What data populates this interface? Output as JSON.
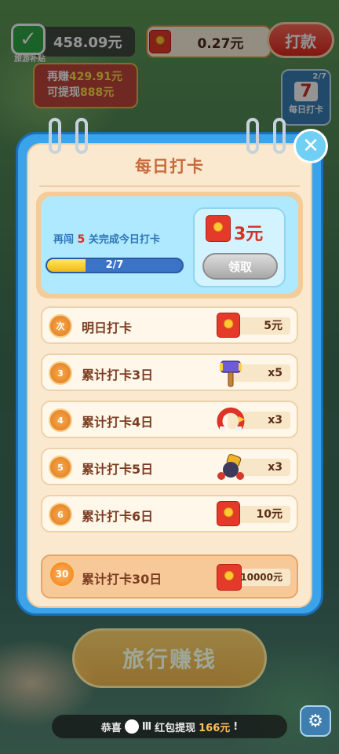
{
  "hud": {
    "balance": "458.09元",
    "subsidy_label": "旅游补贴",
    "tip_line1_prefix": "再赚",
    "tip_line1_value": "429.91元",
    "tip_line2_prefix": "可提现",
    "tip_line2_value": "888元",
    "redpacket_balance": "0.27元",
    "withdraw_label": "打款",
    "stage_progress": "2/7",
    "stage_number": "7",
    "stage_label": "每日打卡"
  },
  "modal": {
    "title": "每日打卡",
    "progress_prefix": "再闯",
    "progress_count": "5",
    "progress_suffix": "关完成今日打卡",
    "progress_label": "2/7",
    "progress_fraction": 0.2857,
    "reward_amount": "3元",
    "claim_label": "领取",
    "rows": [
      {
        "badge": "次",
        "label": "明日打卡",
        "qty": "5元",
        "icon": "red-packet-icon"
      },
      {
        "badge": "3",
        "label": "累计打卡3日",
        "qty": "x5",
        "icon": "hammer-icon"
      },
      {
        "badge": "4",
        "label": "累计打卡4日",
        "qty": "x3",
        "icon": "magnet-icon"
      },
      {
        "badge": "5",
        "label": "累计打卡5日",
        "qty": "x3",
        "icon": "cannon-icon"
      },
      {
        "badge": "6",
        "label": "累计打卡6日",
        "qty": "10元",
        "icon": "red-packet-icon"
      },
      {
        "badge": "30",
        "label": "累计打卡30日",
        "qty": "10000元",
        "icon": "red-packet-icon"
      }
    ]
  },
  "bottom": {
    "travel_label": "旅行赚钱",
    "ticker_prefix": "恭喜",
    "ticker_user": "Ⅲ",
    "ticker_mid": "红包提现",
    "ticker_amount": "166元",
    "ticker_suffix": "!"
  },
  "colors": {
    "modal_blue": "#3aa3ea",
    "modal_cream": "#fbe9cf",
    "accent_red": "#e22b2b",
    "accent_orange": "#e07a22"
  }
}
